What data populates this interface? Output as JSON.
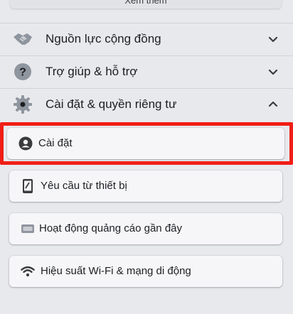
{
  "see_more": {
    "label": "Xem thêm"
  },
  "menu": [
    {
      "label": "Nguồn lực cộng đồng",
      "icon": "handshake-icon",
      "expanded": false
    },
    {
      "label": "Trợ giúp & hỗ trợ",
      "icon": "question-icon",
      "expanded": false
    },
    {
      "label": "Cài đặt & quyền riêng tư",
      "icon": "gear-icon",
      "expanded": true
    }
  ],
  "submenu": [
    {
      "label": "Cài đặt",
      "icon": "user-circle-icon",
      "highlighted": true
    },
    {
      "label": "Yêu cầu từ thiết bị",
      "icon": "phone-icon",
      "highlighted": false
    },
    {
      "label": "Hoạt động quảng cáo gần đây",
      "icon": "ad-icon",
      "highlighted": false
    },
    {
      "label": "Hiệu suất Wi-Fi & mạng di động",
      "icon": "wifi-icon",
      "highlighted": false
    }
  ],
  "colors": {
    "highlight": "#f01e16",
    "background": "#e8e9ed",
    "card": "#f6f6f8"
  }
}
